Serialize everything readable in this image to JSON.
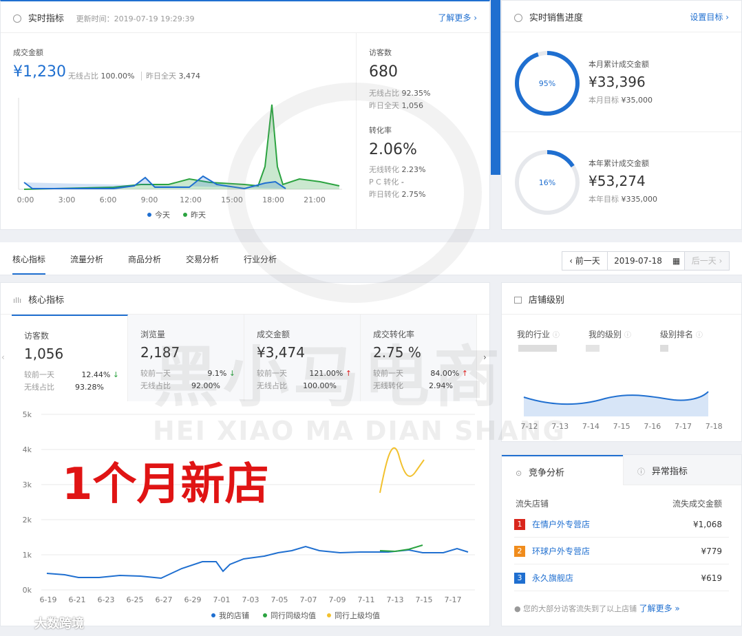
{
  "realtime": {
    "title": "实时指标",
    "update_label": "更新时间：2019-07-19 19:29:39",
    "more": "了解更多 ›",
    "gmv_label": "成交金额",
    "gmv_value": "¥1,230",
    "wireless_label": "无线占比",
    "wireless_value": "100.00%",
    "yesterday_label": "昨日全天",
    "yesterday_value": "3,474",
    "visitors_label": "访客数",
    "visitors_value": "680",
    "v_wireless_label": "无线占比",
    "v_wireless_value": "92.35%",
    "v_yesterday_label": "昨日全天",
    "v_yesterday_value": "1,056",
    "conv_label": "转化率",
    "conv_value": "2.06%",
    "conv_wireless_label": "无线转化",
    "conv_wireless_value": "2.23%",
    "conv_pc_label": "P C 转化",
    "conv_pc_value": "-",
    "conv_yesterday_label": "昨日转化",
    "conv_yesterday_value": "2.75%",
    "legend_today": "今天",
    "legend_yesterday": "昨天",
    "x_ticks": [
      "0:00",
      "3:00",
      "6:00",
      "9:00",
      "12:00",
      "15:00",
      "18:00",
      "21:00"
    ]
  },
  "sales": {
    "title": "实时销售进度",
    "set_goal": "设置目标 ›",
    "month": {
      "pct_label": "95%",
      "pct": 0.95,
      "label": "本月累计成交金额",
      "value": "¥33,396",
      "goal_label": "本月目标",
      "goal_value": "¥35,000"
    },
    "year": {
      "pct_label": "16%",
      "pct": 0.16,
      "label": "本年累计成交金额",
      "value": "¥53,274",
      "goal_label": "本年目标",
      "goal_value": "¥335,000"
    }
  },
  "tabs": [
    "核心指标",
    "流量分析",
    "商品分析",
    "交易分析",
    "行业分析"
  ],
  "date_nav": {
    "prev": "‹ 前一天",
    "date": "2019-07-18",
    "next": "后一天 ›"
  },
  "core": {
    "title": "核心指标",
    "kpis": [
      {
        "label": "访客数",
        "value": "1,056",
        "cmp_label": "较前一天",
        "cmp_value": "12.44%",
        "cmp_dir": "down",
        "sub_label": "无线占比",
        "sub_value": "93.28%"
      },
      {
        "label": "浏览量",
        "value": "2,187",
        "cmp_label": "较前一天",
        "cmp_value": "9.1%",
        "cmp_dir": "down",
        "sub_label": "无线占比",
        "sub_value": "92.00%"
      },
      {
        "label": "成交金额",
        "value": "¥3,474",
        "cmp_label": "较前一天",
        "cmp_value": "121.00%",
        "cmp_dir": "up",
        "sub_label": "无线占比",
        "sub_value": "100.00%"
      },
      {
        "label": "成交转化率",
        "value": "2.75 %",
        "cmp_label": "较前一天",
        "cmp_value": "84.00%",
        "cmp_dir": "up",
        "sub_label": "无线转化",
        "sub_value": "2.94%"
      }
    ],
    "overlay_text": "1个月新店",
    "y_ticks": [
      "5k",
      "4k",
      "3k",
      "2k",
      "1k",
      "0k"
    ],
    "x_ticks": [
      "6-19",
      "6-21",
      "6-23",
      "6-25",
      "6-27",
      "6-29",
      "7-01",
      "7-03",
      "7-05",
      "7-07",
      "7-09",
      "7-11",
      "7-13",
      "7-15",
      "7-17"
    ],
    "legend": [
      "我的店铺",
      "同行同级均值",
      "同行上级均值"
    ]
  },
  "shop_level": {
    "title": "店铺级别",
    "cols": [
      "我的行业",
      "我的级别",
      "级别排名"
    ],
    "x_ticks": [
      "7-12",
      "7-13",
      "7-14",
      "7-15",
      "7-16",
      "7-17",
      "7-18"
    ]
  },
  "competition": {
    "tab_active": "竞争分析",
    "tab_other": "异常指标",
    "col_store": "流失店铺",
    "col_amount": "流失成交金额",
    "rows": [
      {
        "rank": "1",
        "name": "在情户外专营店",
        "amount": "¥1,068",
        "color": "#d9261c"
      },
      {
        "rank": "2",
        "name": "环球户外专营店",
        "amount": "¥779",
        "color": "#f08c1c"
      },
      {
        "rank": "3",
        "name": "永久旗舰店",
        "amount": "¥619",
        "color": "#1f6fd0"
      }
    ],
    "note": "您的大部分访客流失到了以上店铺",
    "note_link": "了解更多 »"
  },
  "watermark": {
    "cn": "黑小马电商",
    "en": "HEI XIAO MA DIAN SHANG",
    "corner": "大数跨境"
  },
  "colors": {
    "accent": "#1f6fd0",
    "green": "#2ba340",
    "yellow": "#f2c12e",
    "red": "#e02020"
  }
}
